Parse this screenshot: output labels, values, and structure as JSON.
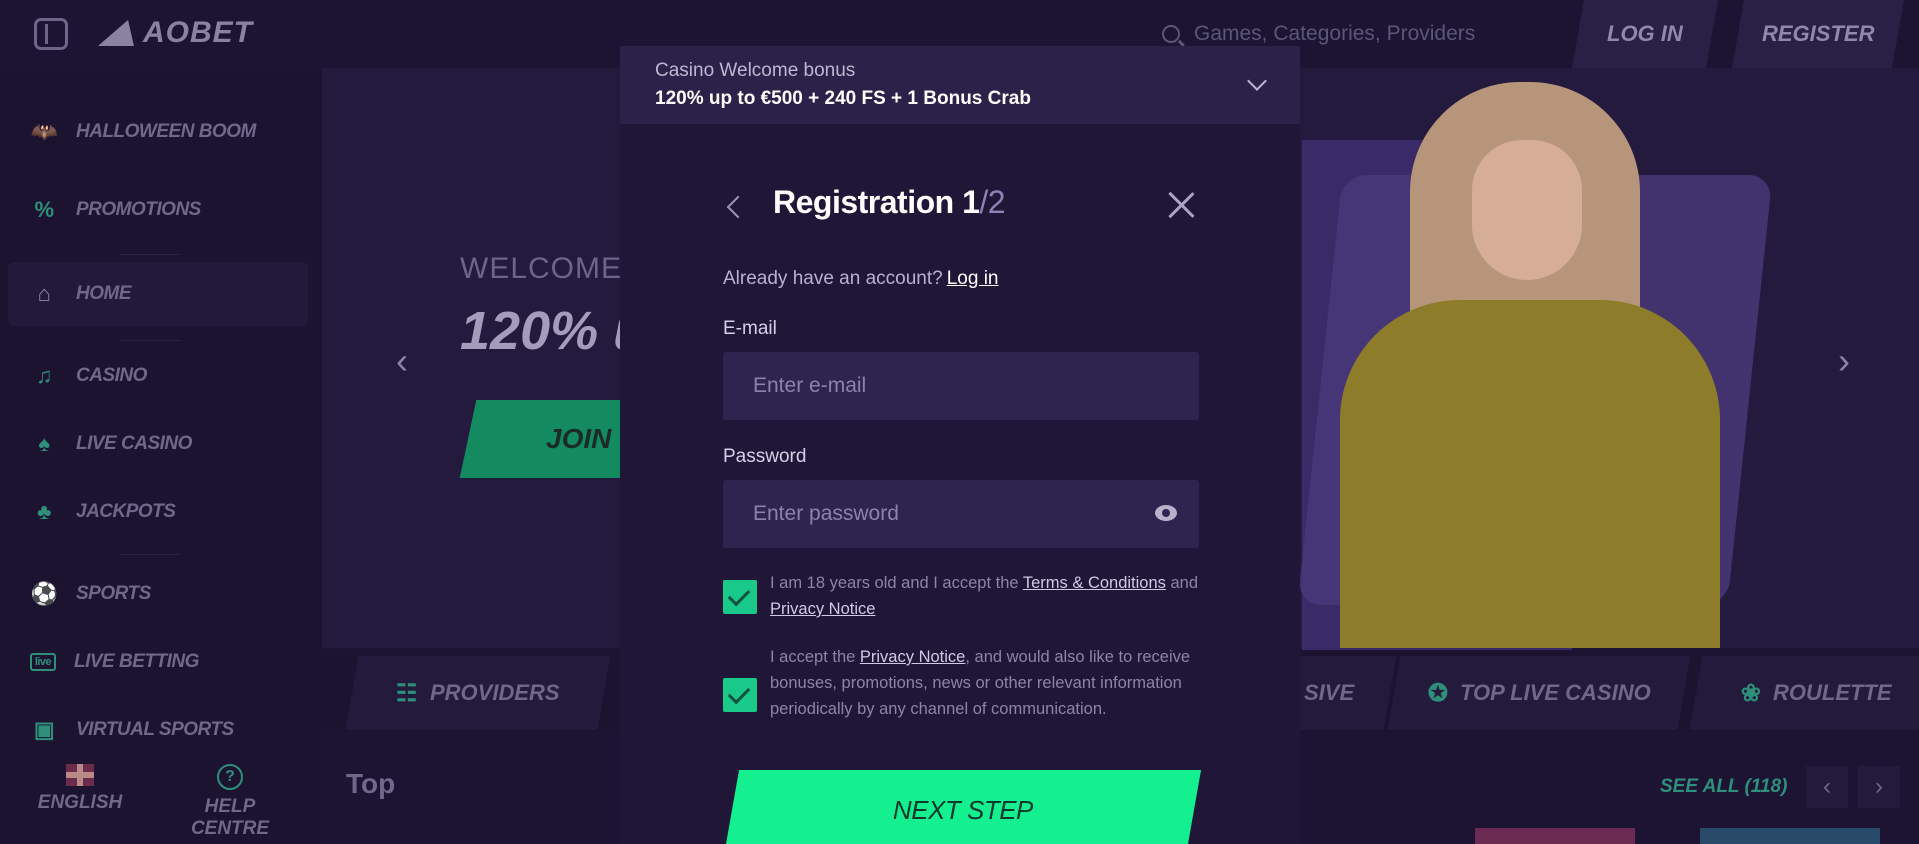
{
  "header": {
    "logo_text": "AOBET",
    "search_placeholder": "Games, Categories, Providers",
    "login_label": "LOG IN",
    "register_label": "REGISTER"
  },
  "sidebar": {
    "items": [
      {
        "label": "HALLOWEEN BOOM",
        "icon": "bat-icon"
      },
      {
        "label": "PROMOTIONS",
        "icon": "percent-icon"
      },
      {
        "label": "HOME",
        "icon": "home-icon"
      },
      {
        "label": "CASINO",
        "icon": "music-note-icon"
      },
      {
        "label": "LIVE CASINO",
        "icon": "cards-icon"
      },
      {
        "label": "JACKPOTS",
        "icon": "clover-icon"
      },
      {
        "label": "SPORTS",
        "icon": "ball-icon"
      },
      {
        "label": "LIVE BETTING",
        "icon": "live-icon"
      },
      {
        "label": "VIRTUAL SPORTS",
        "icon": "monitor-icon"
      }
    ],
    "footer": {
      "language": "ENGLISH",
      "help": "HELP CENTRE"
    }
  },
  "hero": {
    "welcome": "WELCOME",
    "headline": "120% u",
    "join": "JOIN"
  },
  "categories": {
    "providers": "PROVIDERS",
    "exclusive": "SIVE",
    "top_live": "TOP LIVE CASINO",
    "roulette": "ROULETTE"
  },
  "section": {
    "title": "Top",
    "see_all": "SEE ALL (118)"
  },
  "bonus": {
    "label": "Casino Welcome bonus",
    "value": "120% up to €500 + 240 FS + 1 Bonus Crab"
  },
  "modal": {
    "title": "Registration 1",
    "title_sep": "/",
    "title_total": "2",
    "have_account": "Already have an account?",
    "login_link": "Log in",
    "email_label": "E-mail",
    "email_placeholder": "Enter e-mail",
    "password_label": "Password",
    "password_placeholder": "Enter password",
    "terms_pre": "I am 18 years old and I accept the ",
    "terms_link": "Terms & Conditions",
    "terms_mid": " and ",
    "privacy_link": "Privacy Notice",
    "marketing_pre": "I accept the ",
    "marketing_link": "Privacy Notice",
    "marketing_post": ", and would also like to receive bonuses, promotions, news or other relevant information periodically by any channel of communication.",
    "terms_checked": true,
    "marketing_checked": true,
    "next_label": "NEXT STEP"
  },
  "colors": {
    "accent": "#14f08f",
    "background": "#1d1434",
    "modal": "#201638"
  }
}
